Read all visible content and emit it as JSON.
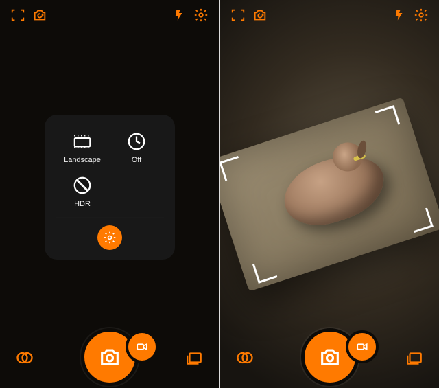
{
  "accent_color": "#ff7a00",
  "screens": {
    "left": {
      "topbar": {
        "focus_icon": "focus-frame-icon",
        "switch_camera_icon": "switch-camera-icon",
        "flash_icon": "flash-icon",
        "settings_icon": "gear-icon"
      },
      "panel": {
        "items": [
          {
            "label": "Landscape",
            "icon": "landscape-icon"
          },
          {
            "label": "Off",
            "icon": "timer-off-icon"
          },
          {
            "label": "HDR",
            "icon": "hdr-icon"
          }
        ],
        "more_settings_icon": "gear-icon"
      },
      "bottombar": {
        "filters_icon": "filters-icon",
        "shutter_icon": "camera-icon",
        "video_icon": "video-icon",
        "gallery_icon": "gallery-icon"
      }
    },
    "right": {
      "topbar": {
        "focus_icon": "focus-frame-icon",
        "switch_camera_icon": "switch-camera-icon",
        "flash_icon": "flash-icon",
        "settings_icon": "gear-icon"
      },
      "viewfinder": {
        "subject": "dog-on-bed",
        "crop_overlay": true
      },
      "bottombar": {
        "filters_icon": "filters-icon",
        "shutter_icon": "camera-icon",
        "video_icon": "video-icon",
        "gallery_icon": "gallery-icon"
      }
    }
  }
}
